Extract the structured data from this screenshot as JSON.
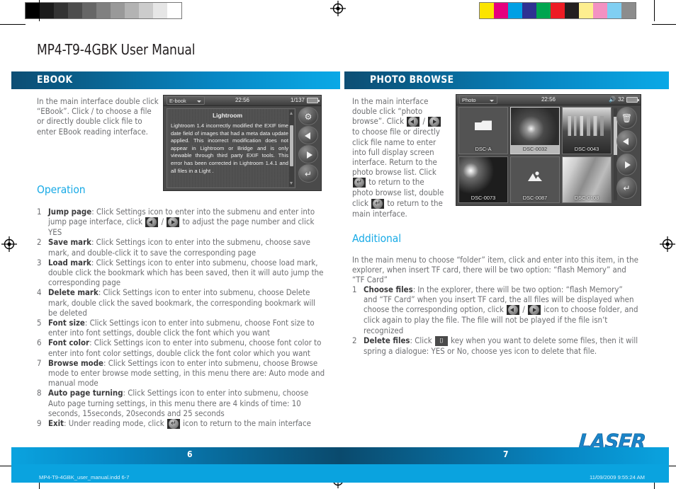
{
  "document": {
    "title": "MP4-T9-4GBK User Manual",
    "footer_file": "MP4-T9-4GBK_user_manual.indd   6-7",
    "footer_timestamp": "11/09/2009   9:55:24 AM",
    "brand_logo": "LASER",
    "page_left": "6",
    "page_right": "7"
  },
  "colors": {
    "bar_dark_blue": "#0d4e74",
    "bar_light_blue": "#0aa8e6",
    "heading_cyan": "#18aae6",
    "body_gray": "#6d6e71",
    "bold_gray": "#3b3b3d"
  },
  "calibration": {
    "gray_strip": [
      "#000000",
      "#1b1b1b",
      "#333333",
      "#4d4d4d",
      "#666666",
      "#808080",
      "#999999",
      "#b3b3b3",
      "#cccccc",
      "#e6e6e6",
      "#ffffff"
    ],
    "color_strip": [
      "#fbe400",
      "#e6007e",
      "#00a0e4",
      "#2e3192",
      "#00a550",
      "#ed1c24",
      "#231f20",
      "#fdee8f",
      "#f391c2",
      "#80cff2",
      "#8c8c8c"
    ]
  },
  "left_section": {
    "header": "EBOOK",
    "intro": "In the main interface double click “EBook”. Click / to choose a file or directly double click file to enter EBook reading interface.",
    "subheading": "Operation",
    "steps": [
      {
        "num": "1",
        "term": "Jump page",
        "text_before": ": Click Settings icon to enter into the submenu and enter into jump page interface, click ",
        "icons": [
          "prev-icon",
          "next-icon"
        ],
        "text_after": " to adjust the page number and click YES"
      },
      {
        "num": "2",
        "term": "Save mark",
        "text_before": ": Click Settings icon to enter into the submenu, choose save mark, and double-click it to save the corresponding page",
        "icons": [],
        "text_after": ""
      },
      {
        "num": "3",
        "term": "Load mark",
        "text_before": ": Click Settings icon to enter into submenu, choose load mark, double click the bookmark which has been saved, then it will auto jump the corresponding page",
        "icons": [],
        "text_after": ""
      },
      {
        "num": "4",
        "term": "Delete mark",
        "text_before": ": Click Settings icon to enter into submenu, choose Delete mark, double click the saved bookmark, the corresponding bookmark will be deleted",
        "icons": [],
        "text_after": ""
      },
      {
        "num": "5",
        "term": "Font size",
        "text_before": ": Click Settings icon to enter into submenu, choose Font size to enter into font settings, double click the font which you want",
        "icons": [],
        "text_after": ""
      },
      {
        "num": "6",
        "term": "Font color",
        "text_before": ": Click Settings icon to enter into submenu, choose font color to enter into font color settings, double click the font color which you want",
        "icons": [],
        "text_after": ""
      },
      {
        "num": "7",
        "term": "Browse mode",
        "text_before": ": Click Settings icon to enter into submenu, choose Browse mode to enter browse mode setting, in this menu there are: Auto mode and manual mode",
        "icons": [],
        "text_after": ""
      },
      {
        "num": "8",
        "term": "Auto page turning",
        "text_before": ": Click Settings icon to enter into submenu, choose Auto page turning settings, in this menu there are 4 kinds of time: 10 seconds, 15seconds, 20seconds and 25 seconds",
        "icons": [],
        "text_after": ""
      },
      {
        "num": "9",
        "term": "Exit",
        "text_before": ": Under reading mode, click ",
        "icons": [
          "return-icon"
        ],
        "text_after": " icon to return to the main interface"
      }
    ]
  },
  "right_section": {
    "header": "PHOTO BROWSE",
    "intro_part1": "In the main interface double click “photo browse”. Click ",
    "intro_part2": " to choose file or directly click file name to enter into full display screen interface. Return to the photo browse list. Click ",
    "intro_part3": " to return to the photo browse list, double click ",
    "intro_part4": " to return to the main interface.",
    "subheading": "Additional",
    "intro2": "In the main menu to choose “folder” item, click and enter into this item, in the explorer, when insert TF card, there will be two option: “flash Memory” and “TF Card”",
    "steps": [
      {
        "num": "1",
        "term": "Choose files",
        "text_before": ": In the explorer, there will be two option: “flash Memory” and “TF Card” when you insert TF card, the all files will be displayed when choose the corresponding option, click ",
        "icons": [
          "prev-icon",
          "next-icon"
        ],
        "text_after": " icon to choose folder, and click again to play the file. The file will not be played if the file isn’t recognized"
      },
      {
        "num": "2",
        "term": "Delete files",
        "text_before": ": Click ",
        "icons": [
          "trash-icon"
        ],
        "text_after": " key when you want to delete some files, then it will spring a dialogue: YES or No, choose yes icon to delete that file."
      }
    ]
  },
  "ebook_device": {
    "status_mode": "E-book",
    "status_time": "22:56",
    "status_page": "1/137",
    "content_title": "Lightroom",
    "content_body": "Lightroom 1.4 incorrectly modified the EXIF time date field of images that had a meta data update applied. This incorrect modification does not appear in Lightroom or Bridge and is only viewable through third party EXIF tools. This error has been corrected in Lightroom 1.4.1 and all files in a Light .",
    "buttons": [
      "settings-icon",
      "prev-icon",
      "next-icon",
      "return-icon"
    ]
  },
  "photo_device": {
    "status_mode": "Photo",
    "status_time": "22:56",
    "status_volume": "32",
    "thumbnails": [
      {
        "caption": "DSC-A",
        "kind": "folder",
        "selected": false
      },
      {
        "caption": "DSC-0032",
        "kind": "flower",
        "selected": true
      },
      {
        "caption": "DSC-0043",
        "kind": "city",
        "selected": false
      },
      {
        "caption": "DSC-0073",
        "kind": "space",
        "selected": false
      },
      {
        "caption": "DSC-0087",
        "kind": "picture",
        "selected": false
      },
      {
        "caption": "DSC-0108",
        "kind": "leaf",
        "selected": false
      }
    ],
    "buttons": [
      "trash-icon",
      "prev-icon",
      "next-icon",
      "return-icon"
    ]
  }
}
